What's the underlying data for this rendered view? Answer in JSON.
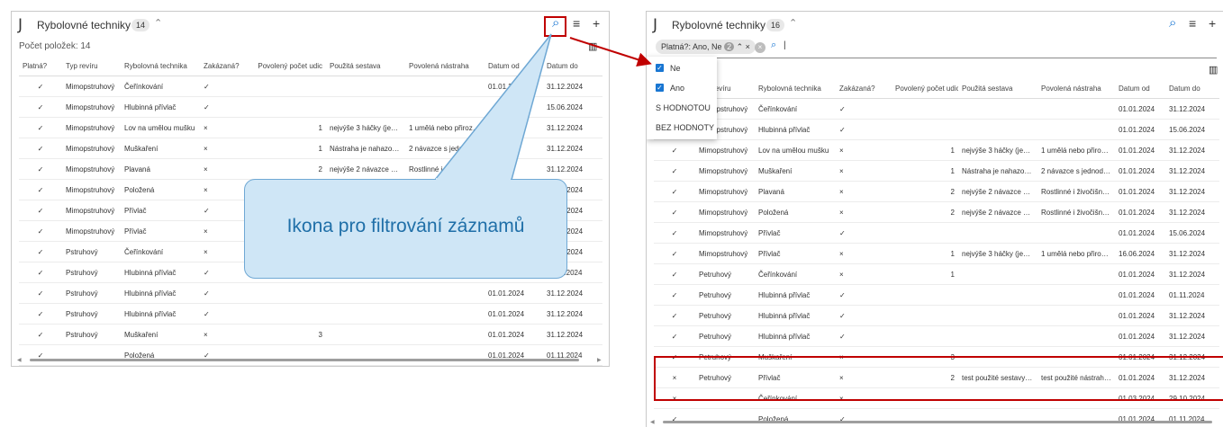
{
  "columns": [
    "Platná?",
    "Typ revíru",
    "Rybolovná technika",
    "Zakázaná?",
    "Povolený počet udic",
    "Použitá sestava",
    "Povolená nástraha",
    "Datum od",
    "Datum do"
  ],
  "left": {
    "title": "Rybolovné techniky",
    "badge": "14",
    "count_label": "Počet položek: 14",
    "rows": [
      [
        "✓",
        "Mimopstruhový",
        "Čeřínkování",
        "✓",
        "",
        "",
        "",
        "01.01.2024",
        "31.12.2024"
      ],
      [
        "✓",
        "Mimopstruhový",
        "Hlubinná přívlač",
        "✓",
        "",
        "",
        "",
        "",
        "15.06.2024"
      ],
      [
        "✓",
        "Mimopstruhový",
        "Lov na umělou mušku",
        "×",
        "1",
        "nejvýše 3 háčky (jedno, ...",
        "1 umělá nebo přirozená ...",
        "",
        "31.12.2024"
      ],
      [
        "✓",
        "Mimopstruhový",
        "Muškaření",
        "×",
        "1",
        "Nástraha je nahazována...",
        "2 návazce s jednoduchý...",
        "2024",
        "31.12.2024"
      ],
      [
        "✓",
        "Mimopstruhový",
        "Plavaná",
        "×",
        "2",
        "nejvýše 2 návazce s jed...",
        "Rostlinné i živočišné. Ná...",
        "2024",
        "31.12.2024"
      ],
      [
        "✓",
        "Mimopstruhový",
        "Položená",
        "×",
        "",
        "",
        "",
        "",
        "31.12.2024"
      ],
      [
        "✓",
        "Mimopstruhový",
        "Přívlač",
        "✓",
        "",
        "",
        "",
        "",
        "15.06.2024"
      ],
      [
        "✓",
        "Mimopstruhový",
        "Přívlač",
        "×",
        "",
        "",
        "",
        "",
        "31.12.2024"
      ],
      [
        "✓",
        "Pstruhový",
        "Čeřínkování",
        "×",
        "",
        "",
        "",
        "",
        "31.12.2024"
      ],
      [
        "✓",
        "Pstruhový",
        "Hlubinná přívlač",
        "✓",
        "",
        "",
        "",
        "",
        "01.11.2024"
      ],
      [
        "✓",
        "Pstruhový",
        "Hlubinná přívlač",
        "✓",
        "",
        "",
        "",
        "01.01.2024",
        "31.12.2024"
      ],
      [
        "✓",
        "Pstruhový",
        "Hlubinná přívlač",
        "✓",
        "",
        "",
        "",
        "01.01.2024",
        "31.12.2024"
      ],
      [
        "✓",
        "Pstruhový",
        "Muškaření",
        "×",
        "3",
        "",
        "",
        "01.01.2024",
        "31.12.2024"
      ],
      [
        "✓",
        "",
        "Položená",
        "✓",
        "",
        "",
        "",
        "01.01.2024",
        "01.11.2024"
      ]
    ]
  },
  "callout": {
    "text": "Ikona pro filtrování záznamů"
  },
  "right": {
    "title": "Rybolovné techniky",
    "badge": "16",
    "filter_chip": "Platná?: Ano, Ne",
    "filter_chip_count": "2",
    "search_value": "",
    "filter_options": [
      {
        "label": "Ne",
        "checked": true
      },
      {
        "label": "Ano",
        "checked": true
      },
      {
        "label": "S HODNOTOU",
        "checked": false
      },
      {
        "label": "BEZ HODNOTY",
        "checked": false
      }
    ],
    "rows": [
      [
        "✓",
        "Mimopstruhový",
        "Čeřínkování",
        "✓",
        "",
        "",
        "",
        "01.01.2024",
        "31.12.2024"
      ],
      [
        "✓",
        "Mimopstruhový",
        "Hlubinná přívlač",
        "✓",
        "",
        "",
        "",
        "01.01.2024",
        "15.06.2024"
      ],
      [
        "✓",
        "Mimopstruhový",
        "Lov na umělou mušku",
        "×",
        "1",
        "nejvýše 3 háčky (jedno, ...",
        "1 umělá nebo přirozená ...",
        "01.01.2024",
        "31.12.2024"
      ],
      [
        "✓",
        "Mimopstruhový",
        "Muškaření",
        "×",
        "1",
        "Nástraha je nahazována...",
        "2 návazce s jednoduchý...",
        "01.01.2024",
        "31.12.2024"
      ],
      [
        "✓",
        "Mimopstruhový",
        "Plavaná",
        "×",
        "2",
        "nejvýše 2 návazce s jed...",
        "Rostlinné i živočišné. Ná...",
        "01.01.2024",
        "31.12.2024"
      ],
      [
        "✓",
        "Mimopstruhový",
        "Položená",
        "×",
        "2",
        "nejvýše 2 návazce s jed...",
        "Rostlinné i živočišné. Ná...",
        "01.01.2024",
        "31.12.2024"
      ],
      [
        "✓",
        "Mimopstruhový",
        "Přívlač",
        "✓",
        "",
        "",
        "",
        "01.01.2024",
        "15.06.2024"
      ],
      [
        "✓",
        "Mimopstruhový",
        "Přívlač",
        "×",
        "1",
        "nejvýše 3 háčky (jedno, ...",
        "1 umělá nebo přirozená ...",
        "16.06.2024",
        "31.12.2024"
      ],
      [
        "✓",
        "Petruhový",
        "Čeřínkování",
        "×",
        "1",
        "",
        "",
        "01.01.2024",
        "31.12.2024"
      ],
      [
        "✓",
        "Petruhový",
        "Hlubinná přívlač",
        "✓",
        "",
        "",
        "",
        "01.01.2024",
        "01.11.2024"
      ],
      [
        "✓",
        "Petruhový",
        "Hlubinná přívlač",
        "✓",
        "",
        "",
        "",
        "01.01.2024",
        "31.12.2024"
      ],
      [
        "✓",
        "Petruhový",
        "Hlubinná přívlač",
        "✓",
        "",
        "",
        "",
        "01.01.2024",
        "31.12.2024"
      ],
      [
        "✓",
        "Petruhový",
        "Muškaření",
        "×",
        "3",
        "",
        "",
        "01.01.2024",
        "31.12.2024"
      ],
      [
        "×",
        "Petruhový",
        "Přívlač",
        "×",
        "2",
        "test použité sestavy 123...",
        "test použité nástrahy 12...",
        "01.01.2024",
        "31.12.2024"
      ],
      [
        "×",
        "",
        "Čeřínkování",
        "×",
        "",
        "",
        "",
        "01.03.2024",
        "29.10.2024"
      ],
      [
        "✓",
        "",
        "Položená",
        "✓",
        "",
        "",
        "",
        "01.01.2024",
        "01.11.2024"
      ]
    ]
  },
  "colors": {
    "accent": "#1976d2",
    "highlight": "#c00000",
    "callout_fill": "#cfe6f6",
    "callout_border": "#6fa8d4"
  }
}
